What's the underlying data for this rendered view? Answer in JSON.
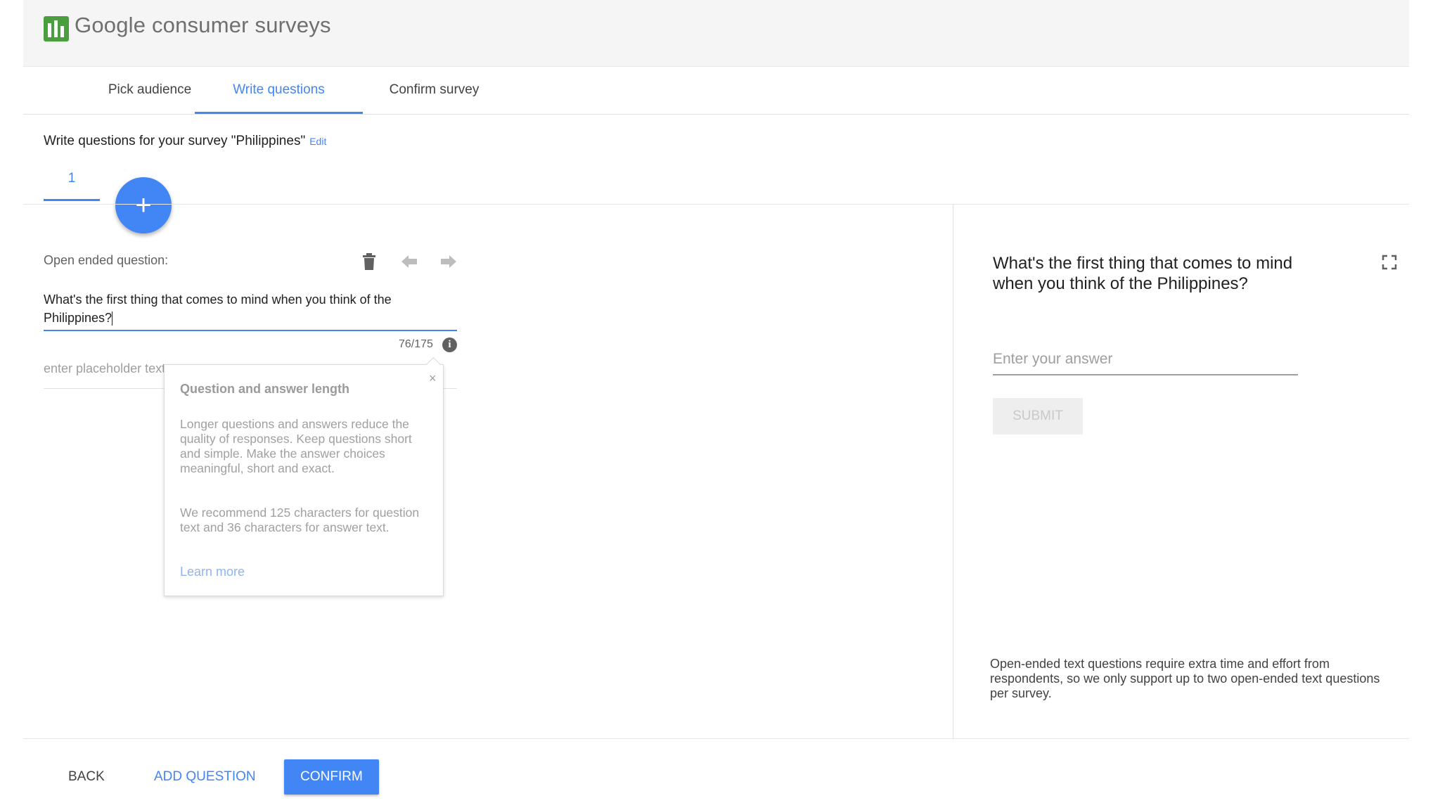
{
  "app": {
    "logo_text": "Google consumer surveys",
    "logo_icon": "bar-chart-icon",
    "brand_color": "#4a9e3f"
  },
  "tabs": [
    {
      "label": "Pick audience",
      "active": false
    },
    {
      "label": "Write questions",
      "active": true
    },
    {
      "label": "Confirm survey",
      "active": false
    }
  ],
  "survey": {
    "title_prefix": "Write questions for your survey \"Philippines\"",
    "edit_label": "Edit"
  },
  "question_tabs": [
    "1"
  ],
  "add_icon": "plus-icon",
  "editor": {
    "type_label": "Open ended question:",
    "tools": [
      "trash-icon",
      "arrow-left-icon",
      "arrow-right-icon"
    ],
    "question_text": "What's the first thing that comes to mind when you think of the Philippines?",
    "char_count": "76/175",
    "info_glyph": "i",
    "placeholder_label": "enter placeholder text"
  },
  "tooltip": {
    "close": "×",
    "title": "Question and answer length",
    "p1": "Longer questions and answers reduce the quality of responses. Keep questions short and simple. Make the answer choices meaningful, short and exact.",
    "p2": "We recommend 125 characters for question text and 36 characters for answer text.",
    "link": "Learn more"
  },
  "preview": {
    "question": "What's the first thing that comes to mind when you think of the Philippines?",
    "answer_placeholder": "Enter your answer",
    "submit_label": "SUBMIT",
    "note": "Open-ended text questions require extra time and effort from respondents, so we only support up to two open-ended text questions per survey."
  },
  "footer": {
    "back_label": "BACK",
    "add_label": "ADD QUESTION",
    "confirm_label": "CONFIRM"
  },
  "colors": {
    "accent": "#4285f4",
    "header_bg": "#f5f5f5"
  }
}
